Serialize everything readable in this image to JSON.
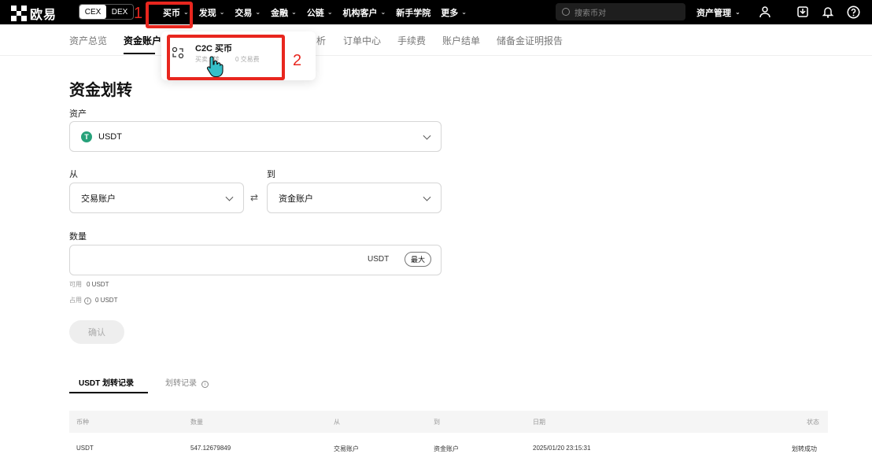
{
  "topbar": {
    "logo_text": "欧易",
    "segment": {
      "cex": "CEX",
      "dex": "DEX"
    },
    "nav": [
      {
        "label": "买币",
        "chevron": true
      },
      {
        "label": "发现",
        "chevron": true
      },
      {
        "label": "交易",
        "chevron": true
      },
      {
        "label": "金融",
        "chevron": true
      },
      {
        "label": "公链",
        "chevron": true
      },
      {
        "label": "机构客户",
        "chevron": true
      },
      {
        "label": "新手学院",
        "chevron": false
      },
      {
        "label": "更多",
        "chevron": true
      }
    ],
    "search_placeholder": "搜索币对",
    "asset_management": "资产管理"
  },
  "subnav": [
    "资产总览",
    "资金账户",
    "析",
    "订单中心",
    "手续费",
    "账户结单",
    "储备金证明报告"
  ],
  "dropdown": {
    "title": "C2C 买币",
    "sub_left": "买卖...转",
    "sub_right": "0 交易费"
  },
  "annotations": {
    "one": "1",
    "two": "2"
  },
  "form": {
    "title": "资金划转",
    "asset_label": "资产",
    "asset_value": "USDT",
    "from_label": "从",
    "from_value": "交易账户",
    "to_label": "到",
    "to_value": "资金账户",
    "amount_label": "数量",
    "amount_unit": "USDT",
    "max_button": "最大",
    "available_key": "可用",
    "available_value": "0 USDT",
    "occupied_key": "占用",
    "occupied_value": "0 USDT",
    "confirm_button": "确认"
  },
  "records": {
    "tabs": [
      "USDT 划转记录",
      "划转记录"
    ],
    "columns": [
      "币种",
      "数量",
      "从",
      "到",
      "日期",
      "状态"
    ],
    "rows": [
      [
        "USDT",
        "547.12679849",
        "交易账户",
        "资金账户",
        "2025/01/20 23:15:31",
        "划转成功"
      ]
    ]
  },
  "colors": {
    "accent_red": "#e8261e",
    "tether_green": "#27a17a"
  }
}
